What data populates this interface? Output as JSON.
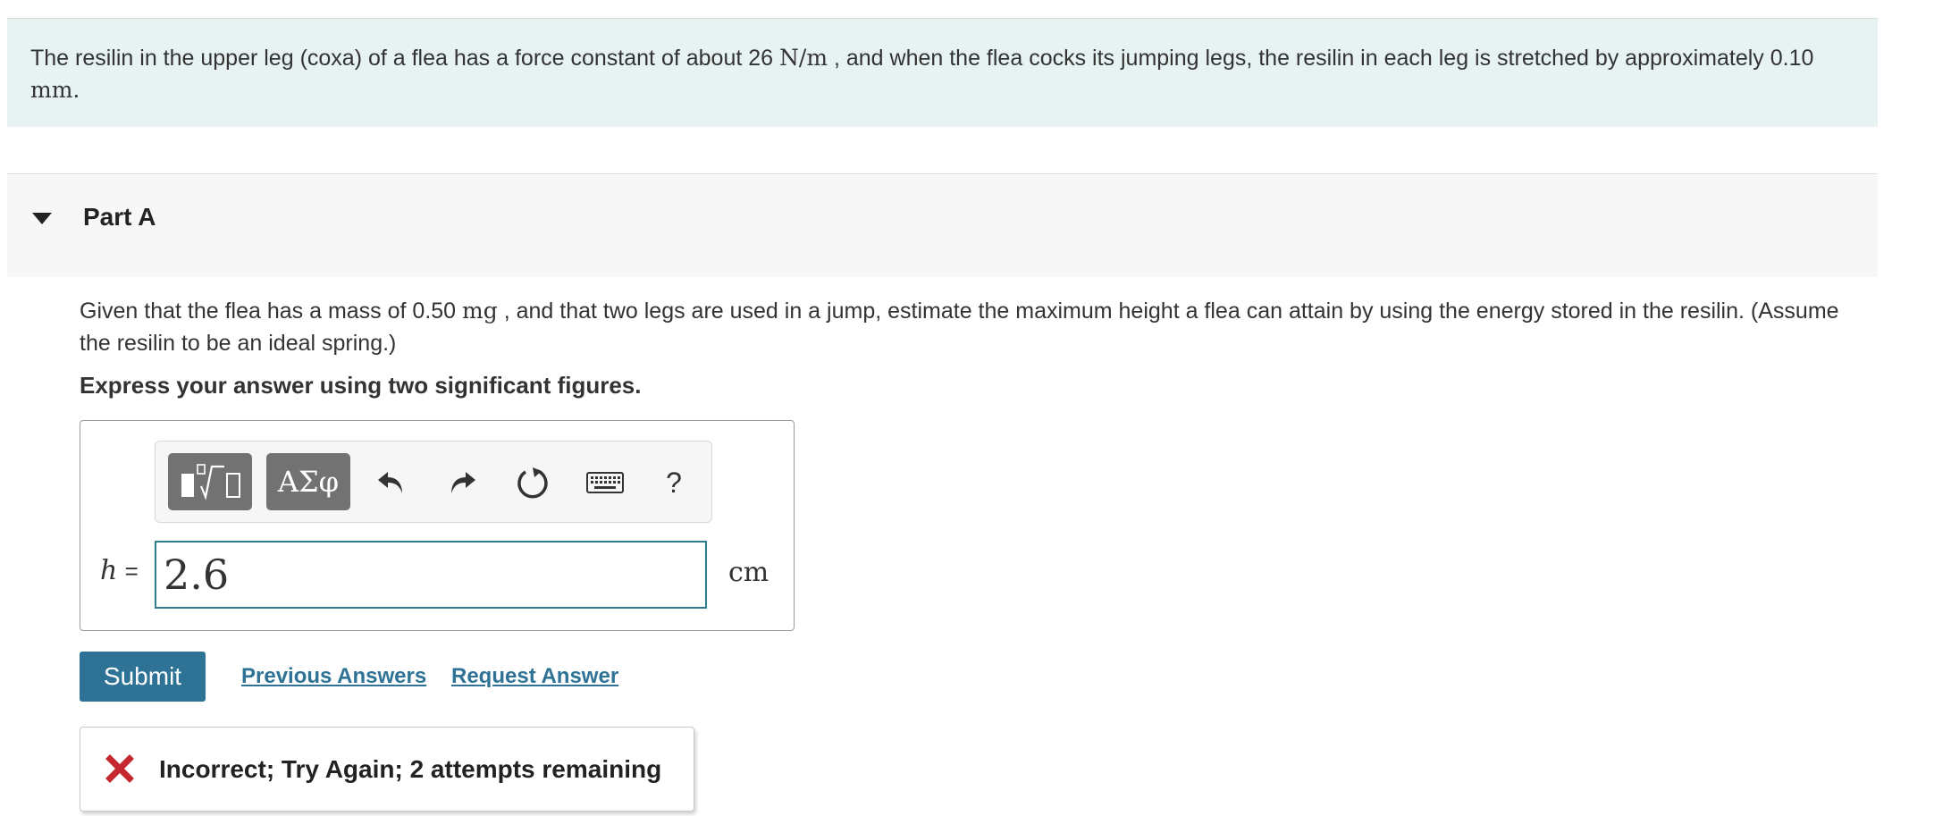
{
  "intro": {
    "text_1": "The resilin in the upper leg (coxa) of a flea has a force constant of about 26 ",
    "unit_1": "N/m",
    "text_2": " , and when the flea cocks its jumping legs, the resilin in each leg is stretched by approximately 0.10 ",
    "unit_2": "mm",
    "text_3": "."
  },
  "part": {
    "title": "Part A",
    "question_1": "Given that the flea has a mass of 0.50 ",
    "question_unit": "mg",
    "question_2": " , and that two legs are used in a jump, estimate the maximum height a flea can attain by using the energy stored in the resilin. (Assume the resilin to be an ideal spring.)",
    "instruction": "Express your answer using two significant figures."
  },
  "toolbar": {
    "templates_icon": "templates-icon",
    "greek_label": "ΑΣφ",
    "undo_icon": "undo-icon",
    "redo_icon": "redo-icon",
    "reset_icon": "reset-icon",
    "keyboard_icon": "keyboard-icon",
    "help_label": "?"
  },
  "answer": {
    "variable": "h",
    "equals": "=",
    "value": "2.6",
    "unit": "cm"
  },
  "actions": {
    "submit_label": "Submit",
    "previous_answers_label": "Previous Answers",
    "request_answer_label": "Request Answer"
  },
  "feedback": {
    "icon": "incorrect-x-icon",
    "message": "Incorrect; Try Again; 2 attempts remaining",
    "color": "#c5282f"
  },
  "colors": {
    "intro_background": "#e7f3f3",
    "accent": "#2e7396",
    "input_border": "#2e7d8e"
  }
}
